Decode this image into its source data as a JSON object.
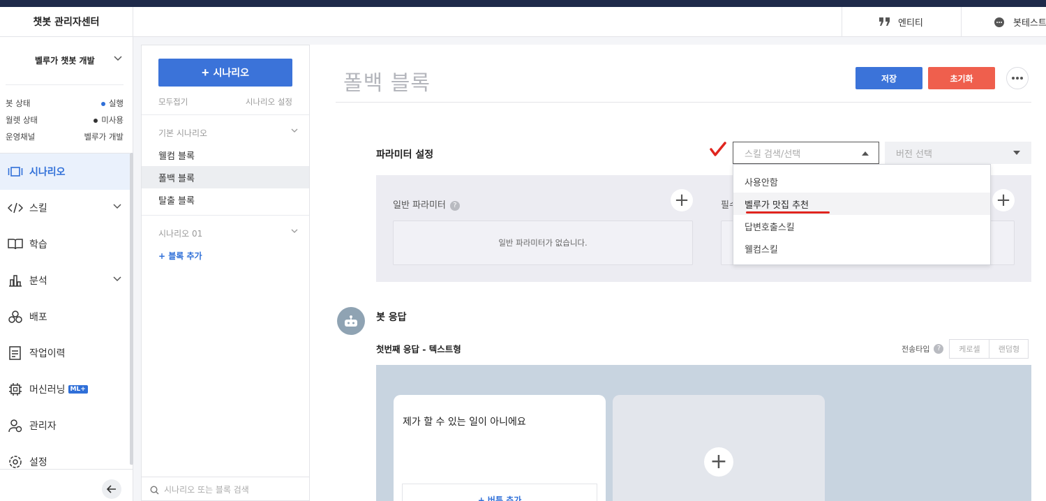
{
  "header": {
    "brand": "챗봇 관리자센터",
    "entity_label": "엔티티",
    "bottest_label": "봇테스트"
  },
  "sidebar": {
    "bot_name": "벨루가 챗봇 개발",
    "info": [
      {
        "label": "봇 상태",
        "value": "실행",
        "dot_color": "#2f6fd8"
      },
      {
        "label": "월렛 상태",
        "value": "미사용",
        "dot_color": "#333333"
      },
      {
        "label": "운영채널",
        "value": "벨루가 개발",
        "dot_color": ""
      }
    ],
    "nav": [
      {
        "label": "시나리오",
        "icon": "scenario-icon",
        "active": true,
        "chevron": false
      },
      {
        "label": "스킬",
        "icon": "code-icon",
        "active": false,
        "chevron": true
      },
      {
        "label": "학습",
        "icon": "book-icon",
        "active": false,
        "chevron": false
      },
      {
        "label": "분석",
        "icon": "chart-icon",
        "active": false,
        "chevron": true
      },
      {
        "label": "배포",
        "icon": "deploy-icon",
        "active": false,
        "chevron": false
      },
      {
        "label": "작업이력",
        "icon": "history-icon",
        "active": false,
        "chevron": false
      },
      {
        "label": "머신러닝",
        "icon": "chip-icon",
        "active": false,
        "chevron": false,
        "badge": "ML+"
      },
      {
        "label": "관리자",
        "icon": "admin-icon",
        "active": false,
        "chevron": false
      },
      {
        "label": "설정",
        "icon": "gear-icon",
        "active": false,
        "chevron": false
      }
    ]
  },
  "scenario_panel": {
    "add_button": "시나리오",
    "collapse_all": "모두접기",
    "settings": "시나리오 설정",
    "group1": "기본 시나리오",
    "blocks": [
      "웰컴 블록",
      "폴백 블록",
      "탈출 블록"
    ],
    "active_block_index": 1,
    "group2": "시나리오 01",
    "add_block": "+ 블록 추가",
    "search_placeholder": "시나리오 또는 블록 검색"
  },
  "main": {
    "title": "폴백 블록",
    "save": "저장",
    "reset": "초기화",
    "param_section": "파라미터 설정",
    "skill_placeholder": "스킬 검색/선택",
    "version_placeholder": "버전 선택",
    "general_param": "일반 파라미터",
    "general_param_empty": "일반 파라미터가 없습니다.",
    "required_param_partial": "필수",
    "skill_options": [
      "사용안함",
      "벨루가 맛집 추천",
      "답변호출스킬",
      "웰컴스킬"
    ],
    "highlight_option_index": 1,
    "bot_response": "봇 응답",
    "response_subtitle": "첫번째 응답 - 텍스트형",
    "send_type": "전송타입",
    "send_type_options": [
      "케로셀",
      "랜덤형"
    ],
    "response_text": "제가 할 수 있는 일이 아니에요",
    "add_button_label": "+ 버튼 추가"
  },
  "colors": {
    "primary": "#3b73d9",
    "danger": "#ef5f4d",
    "annotation_red": "#e0251e",
    "topbar": "#1e2a4a"
  }
}
